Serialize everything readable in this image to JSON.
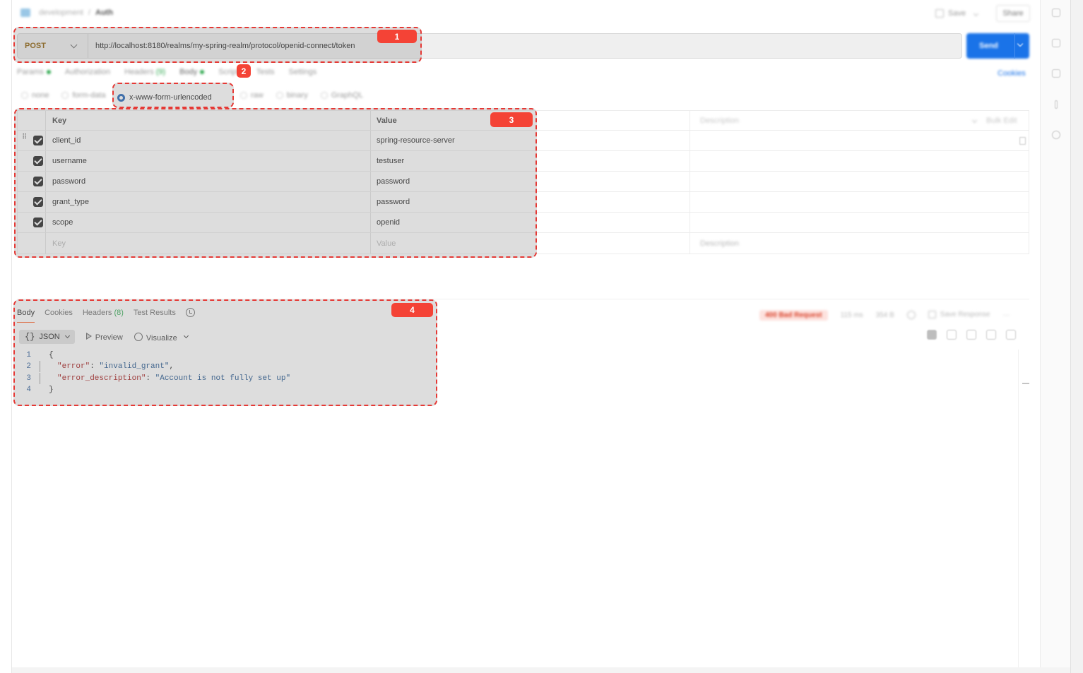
{
  "topbar": {
    "collection_path": "development",
    "separator": "/",
    "request_name": "Auth",
    "save_label": "Save",
    "share_label": "Share"
  },
  "request": {
    "method": "POST",
    "url": "http://localhost:8180/realms/my-spring-realm/protocol/openid-connect/token",
    "send_label": "Send",
    "tabs": [
      {
        "label": "Params",
        "indicator": "dot"
      },
      {
        "label": "Authorization"
      },
      {
        "label": "Headers",
        "count": "(9)"
      },
      {
        "label": "Body",
        "indicator": "dot"
      },
      {
        "label": "Scripts"
      },
      {
        "label": "Tests"
      },
      {
        "label": "Settings"
      }
    ],
    "cookies_label": "Cookies",
    "body_types_before": [
      "none",
      "form-data"
    ],
    "body_type_selected": "x-www-form-urlencoded",
    "body_types_after": [
      "raw",
      "binary",
      "GraphQL"
    ]
  },
  "kv_table": {
    "headers": {
      "key": "Key",
      "value": "Value",
      "description": "Description",
      "bulk_edit": "Bulk Edit"
    },
    "rows": [
      {
        "key": "client_id",
        "value": "spring-resource-server",
        "checked": true
      },
      {
        "key": "username",
        "value": "testuser",
        "checked": true
      },
      {
        "key": "password",
        "value": "password",
        "checked": true
      },
      {
        "key": "grant_type",
        "value": "password",
        "checked": true
      },
      {
        "key": "scope",
        "value": "openid",
        "checked": true
      }
    ],
    "placeholders": {
      "key": "Key",
      "value": "Value",
      "description": "Description"
    }
  },
  "response": {
    "tabs": {
      "body": "Body",
      "cookies": "Cookies",
      "headers": "Headers",
      "headers_count": "(8)",
      "test_results": "Test Results"
    },
    "status": "400 Bad Request",
    "time": "115 ms",
    "size": "354 B",
    "save_response_label": "Save Response",
    "format": "JSON",
    "preview_label": "Preview",
    "visualize_label": "Visualize",
    "code_lines": [
      {
        "n": "1",
        "text": "{"
      },
      {
        "n": "2",
        "key": "\"error\"",
        "colon": ": ",
        "val": "\"invalid_grant\"",
        "tail": ","
      },
      {
        "n": "3",
        "key": "\"error_description\"",
        "colon": ": ",
        "val": "\"Account is not fully set up\"",
        "tail": ""
      },
      {
        "n": "4",
        "text": "}"
      }
    ]
  },
  "annotations": [
    "1",
    "2",
    "3",
    "4"
  ],
  "colors": {
    "send_button": "#1a73e8",
    "method_post": "#8a5a00",
    "highlight_border": "#e53935",
    "badge": "#f44336",
    "status_error": "#d9442c"
  }
}
